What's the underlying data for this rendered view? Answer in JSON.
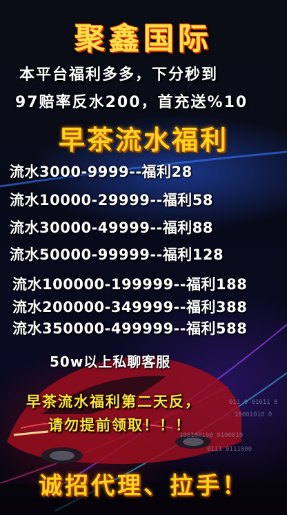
{
  "title": "聚鑫国际",
  "intro_lines": [
    "本平台福利多多，下分秒到",
    "97赔率反水200，首充送%10"
  ],
  "heading": "早茶流水福利",
  "tiers": [
    "流水3000-9999--福利28",
    "流水10000-29999--福利58",
    "流水30000-49999--福利88",
    "流水50000-99999--福利128",
    "流水100000-199999--福利188",
    "流水200000-349999--福利388",
    "流水350000-499999--福利588"
  ],
  "note": "50w以上私聊客服",
  "notice_lines": [
    "早茶流水福利第二天反，",
    "请勿提前领取！！！"
  ],
  "footer": "诚招代理、拉手！",
  "binary_decor": [
    "011 0 01011 0",
    "10001010 0",
    "100100100 0100010",
    "0111 0111000"
  ],
  "colors": {
    "gold": "#ffd21e",
    "white": "#ffffff",
    "car_red": "#c8142a",
    "glow_blue": "#2a5ae6"
  }
}
